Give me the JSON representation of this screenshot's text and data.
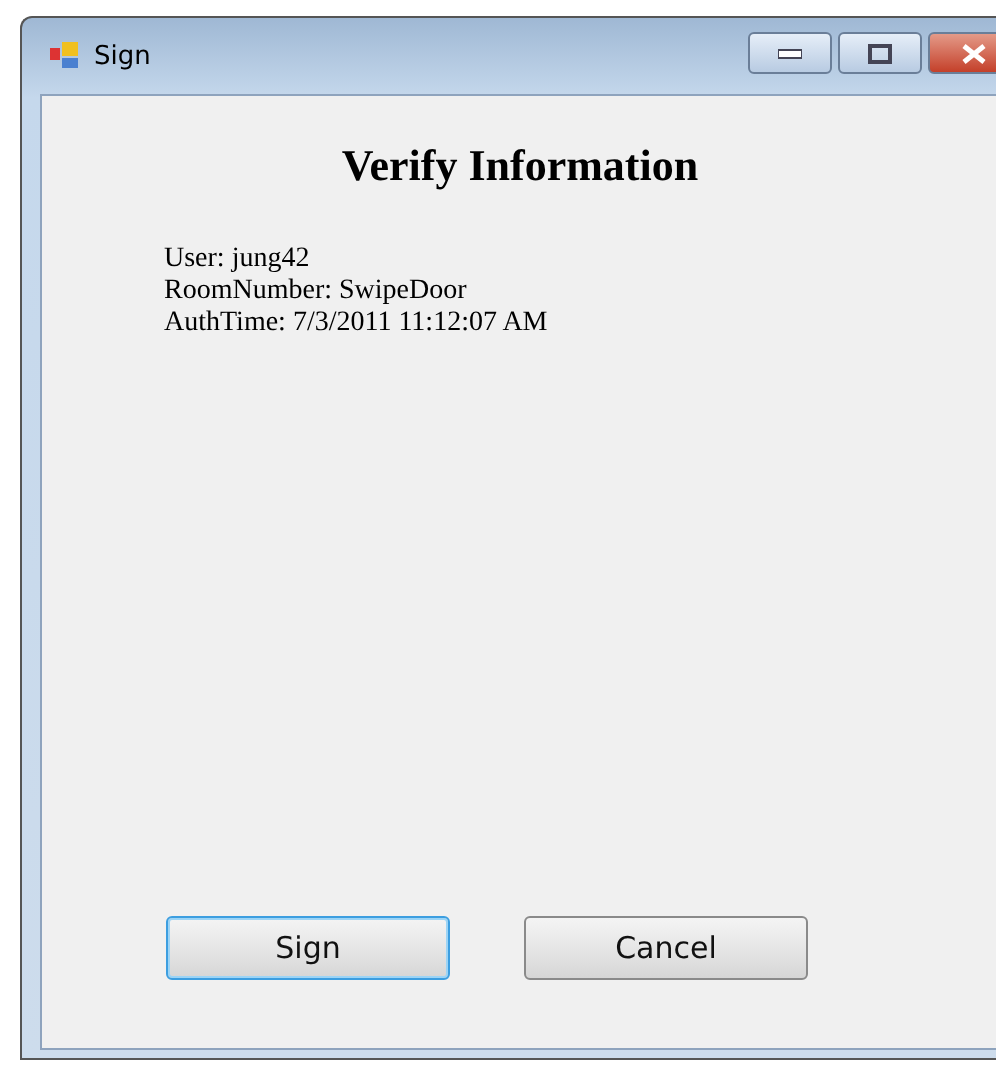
{
  "window": {
    "title": "Sign"
  },
  "heading": "Verify Information",
  "lines": [
    "User: jung42",
    "RoomNumber: SwipeDoor",
    "AuthTime: 7/3/2011 11:12:07 AM"
  ],
  "buttons": [
    {
      "label": "Sign",
      "focused": true
    },
    {
      "label": "Cancel",
      "focused": false
    }
  ]
}
